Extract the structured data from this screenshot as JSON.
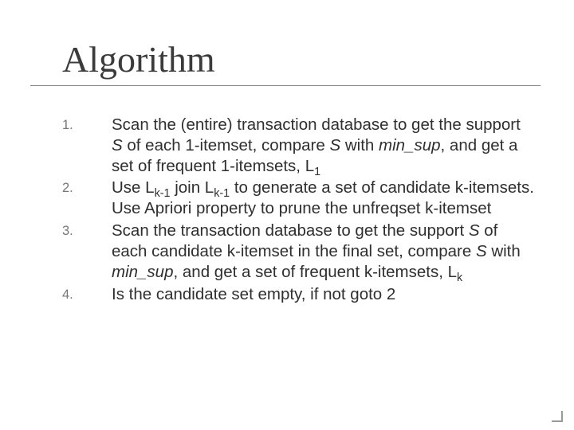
{
  "title": "Algorithm",
  "items": [
    {
      "num": "1.",
      "html": "Scan the (entire) transaction database to get the support <i>S</i> of each 1-itemset,  compare <i>S</i> with <i>min_sup</i>, and  get a set of frequent 1-itemsets, L<sub>1</sub>"
    },
    {
      "num": "2.",
      "html": "Use L<sub>k-1</sub> join L<sub>k-1</sub> to generate a set  of candidate k-itemsets. Use  Apriori property to prune the  unfreqset k-itemset"
    },
    {
      "num": "3.",
      "html": "Scan the transaction database to get  the support <i>S</i> of each candidate  k-itemset in the final set, compare <i>S</i> with <i>min_sup</i>, and get a set of  frequent k-itemsets, L<sub>k</sub>"
    },
    {
      "num": "4.",
      "html": "Is the candidate set empty, if not goto 2"
    }
  ]
}
